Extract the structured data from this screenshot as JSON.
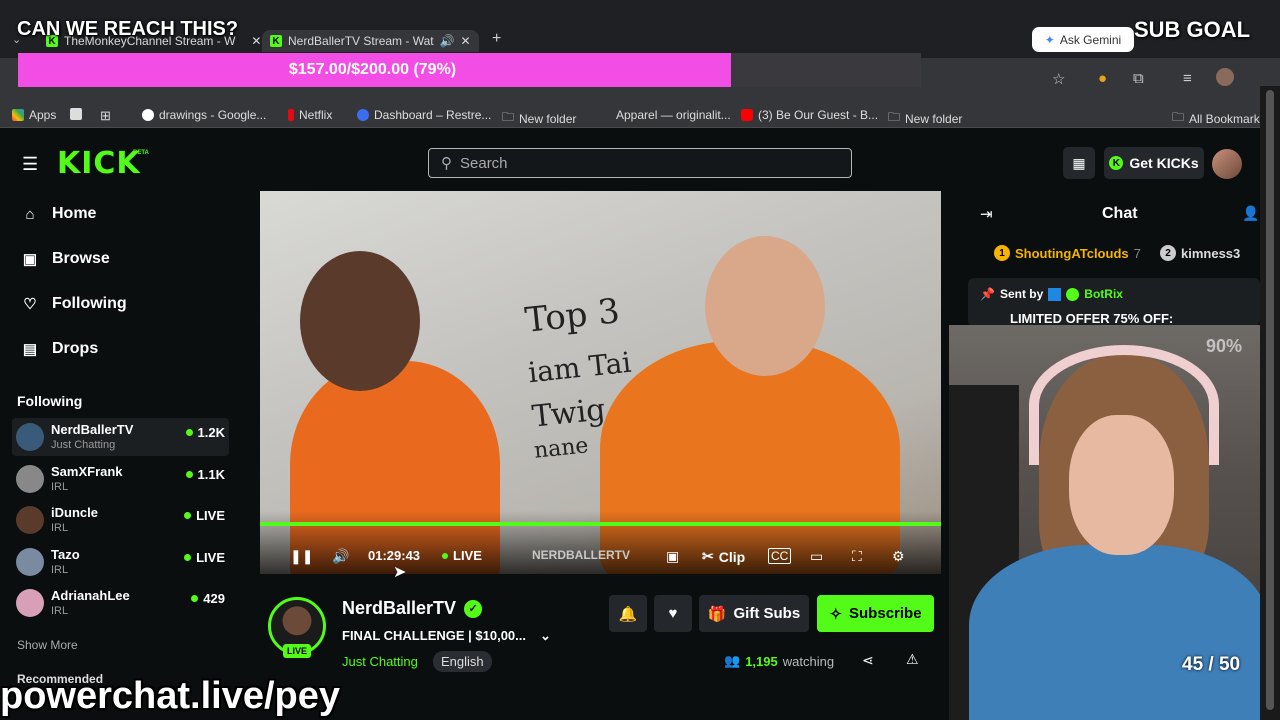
{
  "overlay": {
    "title": "CAN WE REACH THIS?",
    "goal_label": "SUB GOAL",
    "progress_text": "$157.00/$200.00 (79%)",
    "progress_fraction": 0.79,
    "progress_color": "#f24ee6",
    "webcam_percent": "90%",
    "sub_count": "45 / 50",
    "powerchat": "powerchat.live/pey"
  },
  "browser": {
    "tabs": [
      {
        "label": "TheMonkeyChannel Stream - W"
      },
      {
        "label": "NerdBallerTV Stream - Wat"
      }
    ],
    "gemini_label": "Ask Gemini",
    "bookmarks": [
      {
        "label": "Apps"
      },
      {
        "label": "drawings - Google..."
      },
      {
        "label": "Netflix"
      },
      {
        "label": "Dashboard – Restre..."
      },
      {
        "label": "New folder"
      },
      {
        "label": "Apparel — originalit..."
      },
      {
        "label": "(3) Be Our Guest - B..."
      },
      {
        "label": "New folder"
      },
      {
        "label": "All Bookmarks"
      }
    ]
  },
  "header": {
    "logo": "KICK",
    "logo_tag": "BETA",
    "search_placeholder": "Search",
    "get_kicks": "Get KICKs",
    "accent": "#53fc18"
  },
  "sidebar": {
    "nav": [
      {
        "label": "Home",
        "icon": "home-icon"
      },
      {
        "label": "Browse",
        "icon": "browse-icon"
      },
      {
        "label": "Following",
        "icon": "heart-icon"
      },
      {
        "label": "Drops",
        "icon": "drops-icon"
      }
    ],
    "following_heading": "Following",
    "channels": [
      {
        "name": "NerdBallerTV",
        "category": "Just Chatting",
        "viewers": "1.2K"
      },
      {
        "name": "SamXFrank",
        "category": "IRL",
        "viewers": "1.1K"
      },
      {
        "name": "iDuncle",
        "category": "IRL",
        "viewers": "LIVE"
      },
      {
        "name": "Tazo",
        "category": "IRL",
        "viewers": "LIVE"
      },
      {
        "name": "AdrianahLee",
        "category": "IRL",
        "viewers": "429"
      }
    ],
    "show_more": "Show More",
    "recommended": "Recommended"
  },
  "player": {
    "time": "01:29:43",
    "live_label": "LIVE",
    "watermark": "NERDBALLERTV",
    "clip_label": "Clip",
    "graffiti": [
      "Top 3",
      "iam Tai",
      "Twig",
      "nane"
    ]
  },
  "stream": {
    "streamer": "NerdBallerTV",
    "title": "FINAL CHALLENGE | $10,00...",
    "category": "Just Chatting",
    "language": "English",
    "live_badge": "LIVE",
    "gift_subs": "Gift Subs",
    "subscribe": "Subscribe",
    "viewers": "1,195",
    "watching_label": "watching"
  },
  "chat": {
    "title": "Chat",
    "gifters": [
      {
        "rank": "1",
        "name": "ShoutingATclouds",
        "count": "7"
      },
      {
        "rank": "2",
        "name": "kimness3",
        "count": ""
      }
    ],
    "pinned_prefix": "Sent by",
    "pinned_sender": "BotRix",
    "pinned_text": "LIMITED OFFER 75% OFF:"
  }
}
